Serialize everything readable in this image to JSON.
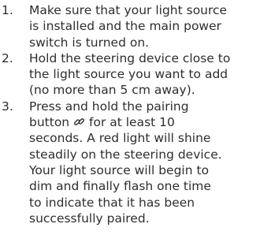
{
  "steps": [
    {
      "number": "1.",
      "lines": [
        "Make sure that your light source",
        "is installed and the main power",
        "switch is turned on."
      ]
    },
    {
      "number": "2.",
      "lines": [
        "Hold the steering device close to",
        "the light source you want to add",
        "(no more than 5 cm away)."
      ]
    },
    {
      "number": "3.",
      "lines": [
        "Press and hold the pairing",
        "button",
        "for at least 10",
        "seconds. A red light will shine",
        "steadily on the steering device.",
        "Your light source will begin to",
        "dim and finally flash one time",
        "to indicate that it has been",
        "successfully paired."
      ]
    }
  ],
  "icons": {
    "pairing": "link-icon"
  }
}
